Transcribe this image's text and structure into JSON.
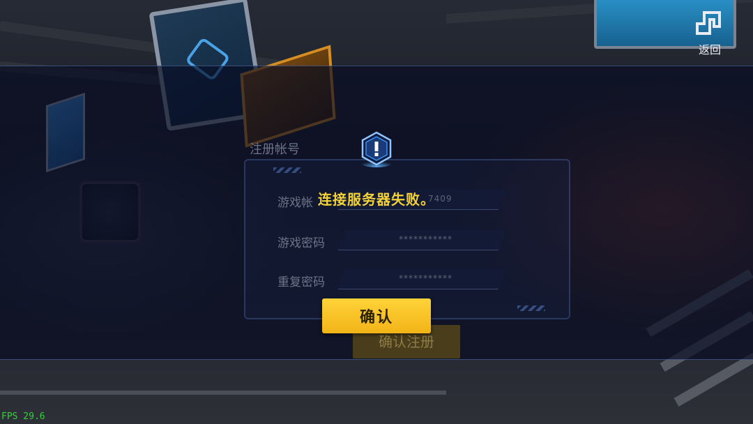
{
  "header": {
    "back_label": "返回",
    "back_icon": "back-arrow-icon"
  },
  "register_form": {
    "title": "注册帐号",
    "account_label": "游戏帐",
    "account_value": "7409",
    "password_label": "游戏密码",
    "password_value": "***********",
    "repeat_password_label": "重复密码",
    "repeat_password_value": "***********",
    "submit_label": "确认注册"
  },
  "dialog": {
    "icon": "warning-exclamation-icon",
    "message": "连接服务器失败。",
    "confirm_label": "确认"
  },
  "status": {
    "fps": "FPS 29.6"
  },
  "colors": {
    "accent_yellow": "#f3d23a",
    "button_yellow": "#ffd23a",
    "badge_blue": "#3e8ff0",
    "fps_green": "#33d13a"
  }
}
